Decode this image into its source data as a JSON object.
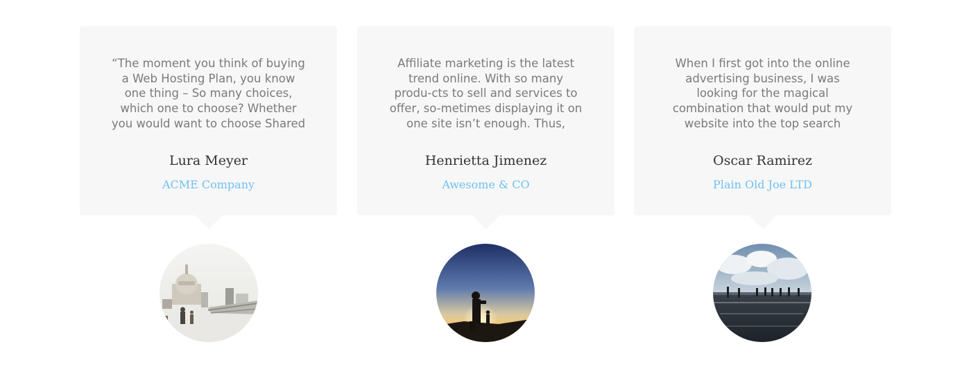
{
  "testimonials": [
    {
      "quote": "“The moment you think of buying a Web Hosting Plan, you know one thing – So many choices, which one to choose? Whether you would want to choose Shared Linux Pac-",
      "name": "Lura Meyer",
      "company": "ACME Company",
      "photo": "city-bridge-photo"
    },
    {
      "quote": "Affiliate marketing is the latest trend online. With so many produ-cts to sell and services to offer, so-metimes displaying it on one site isn’t enough. Thus, advertisers or",
      "name": "Henrietta Jimenez",
      "company": "Awesome & CO",
      "photo": "sunset-silhouette-photo"
    },
    {
      "quote": "When I first got into the online advertising business, I was looking for the magical combination that would put my website into the top search engine rankings, catapult",
      "name": "Oscar Ramirez",
      "company": "Plain Old Joe LTD",
      "photo": "people-in-water-photo"
    }
  ],
  "colors": {
    "card_background": "#f7f7f7",
    "quote_text": "#7a7a7a",
    "name_text": "#333333",
    "company_link": "#6ec1f0"
  }
}
